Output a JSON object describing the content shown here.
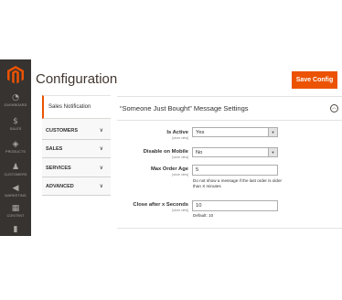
{
  "page": {
    "title": "Configuration"
  },
  "toolbar": {
    "save_label": "Save Config"
  },
  "nav": {
    "items": [
      {
        "label": "DASHBOARD",
        "icon": "dashboard-icon",
        "glyph": "◔"
      },
      {
        "label": "SALES",
        "icon": "dollar-icon",
        "glyph": "$"
      },
      {
        "label": "PRODUCTS",
        "icon": "cube-icon",
        "glyph": "◈"
      },
      {
        "label": "CUSTOMERS",
        "icon": "person-icon",
        "glyph": "♟"
      },
      {
        "label": "MARKETING",
        "icon": "megaphone-icon",
        "glyph": "◀"
      },
      {
        "label": "CONTENT",
        "icon": "content-icon",
        "glyph": "▦"
      },
      {
        "label": "",
        "icon": "reports-icon",
        "glyph": "▮"
      }
    ]
  },
  "config_tabs": {
    "active": "Sales Notification",
    "groups": [
      {
        "label": "CUSTOMERS",
        "chevron": "∨"
      },
      {
        "label": "SALES",
        "chevron": "∨"
      },
      {
        "label": "SERVICES",
        "chevron": "∨"
      },
      {
        "label": "ADVANCED",
        "chevron": "∨"
      }
    ]
  },
  "section": {
    "title": "“Someone Just Bought” Message Settings",
    "toggle": "︿"
  },
  "fields": {
    "is_active": {
      "label": "Is Active",
      "scope": "[store view]",
      "value": "Yes"
    },
    "disable_mobile": {
      "label": "Disable on Mobile",
      "scope": "[store view]",
      "value": "No"
    },
    "max_order_age": {
      "label": "Max Order Age",
      "scope": "[store view]",
      "value": "5",
      "note": "Do not show a message if the last order is older than X minutes"
    },
    "close_after": {
      "label": "Close after x Seconds",
      "scope": "[store view]",
      "value": "10",
      "note": "Default: 10"
    }
  },
  "colors": {
    "accent": "#eb5202",
    "sidebar": "#373330"
  }
}
